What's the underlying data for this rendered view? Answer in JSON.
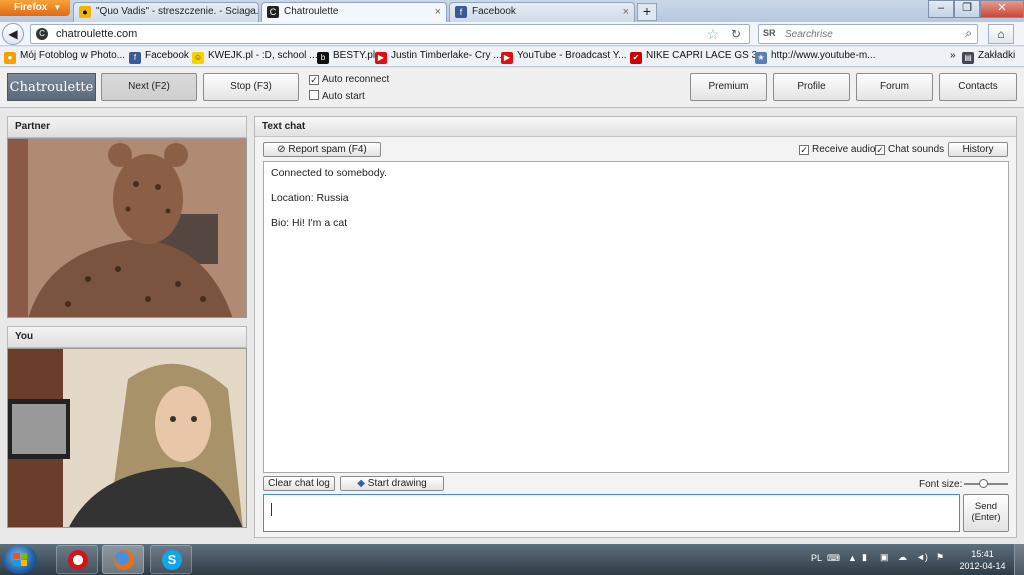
{
  "browser": {
    "menu_label": "Firefox",
    "tabs": [
      {
        "label": "\"Quo Vadis\" - streszczenie. - Sciaga.pl",
        "icon": "sciaga-favicon",
        "active": false
      },
      {
        "label": "Chatroulette",
        "icon": "chatroulette-favicon",
        "active": true
      },
      {
        "label": "Facebook",
        "icon": "facebook-favicon",
        "active": false
      }
    ],
    "new_tab": "+",
    "url": "chatroulette.com",
    "search_engine": "SR",
    "search_placeholder": "Searchrise",
    "bookmarks": [
      {
        "label": "Mój Fotoblog w Photo...",
        "icon": "fotoblog-icon"
      },
      {
        "label": "Facebook",
        "icon": "facebook-icon"
      },
      {
        "label": "KWEJK.pl - :D, school ...",
        "icon": "smiley-icon"
      },
      {
        "label": "BESTY.pl",
        "icon": "besty-icon"
      },
      {
        "label": "Justin Timberlake- Cry ...",
        "icon": "youtube-icon"
      },
      {
        "label": "YouTube - Broadcast Y...",
        "icon": "youtube-icon"
      },
      {
        "label": "NIKE CAPRI LACE GS 3...",
        "icon": "nike-icon"
      },
      {
        "label": "http://www.youtube-m...",
        "icon": "link-icon"
      }
    ],
    "bookmarks_menu": "Zakładki",
    "overflow": "»"
  },
  "app": {
    "logo": "Chatroulette",
    "next_label": "Next (F2)",
    "stop_label": "Stop (F3)",
    "auto_reconnect": {
      "label": "Auto reconnect",
      "checked": true
    },
    "auto_start": {
      "label": "Auto start",
      "checked": false
    },
    "nav": [
      "Premium",
      "Profile",
      "Forum",
      "Contacts"
    ],
    "partner_title": "Partner",
    "you_title": "You",
    "chat": {
      "title": "Text chat",
      "report_spam": "Report spam (F4)",
      "receive_audio": {
        "label": "Receive audio",
        "checked": true
      },
      "chat_sounds": {
        "label": "Chat sounds",
        "checked": true
      },
      "history": "History",
      "messages": [
        "Connected to somebody.",
        "Location: Russia",
        "Bio: Hi! I'm a cat"
      ],
      "clear_log": "Clear chat log",
      "start_drawing": "Start drawing",
      "font_size_label": "Font size:",
      "send_line1": "Send",
      "send_line2": "(Enter)"
    }
  },
  "taskbar": {
    "apps": [
      "opera-icon",
      "firefox-icon",
      "skype-icon"
    ],
    "language": "PL",
    "time": "15:41",
    "date": "2012-04-14"
  }
}
